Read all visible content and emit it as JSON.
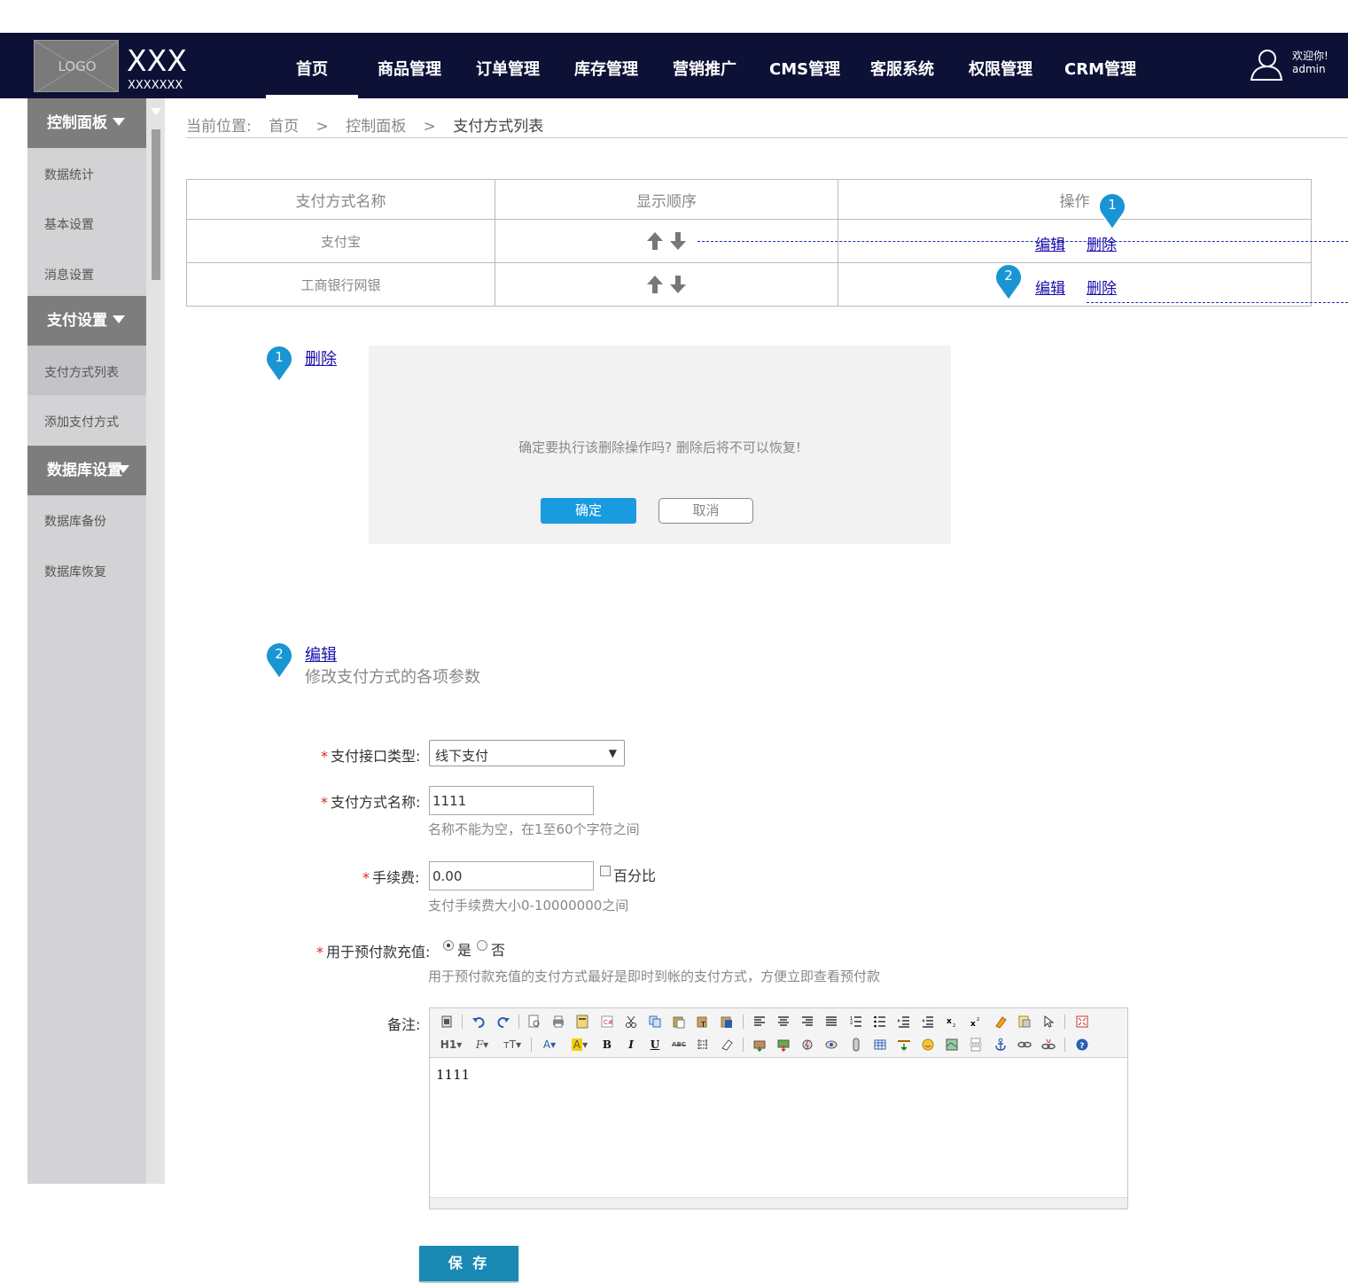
{
  "header": {
    "logo": "LOGO",
    "site_name": "XXX",
    "site_sub": "XXXXXXX",
    "nav": [
      "首页",
      "商品管理",
      "订单管理",
      "库存管理",
      "营销推广",
      "CMS管理",
      "客服系统",
      "权限管理",
      "CRM管理"
    ],
    "welcome": "欢迎你!",
    "username": "admin"
  },
  "sidebar": {
    "sections": [
      {
        "title": "控制面板",
        "items": [
          "数据统计",
          "基本设置",
          "消息设置"
        ]
      },
      {
        "title": "支付设置",
        "items": [
          "支付方式列表",
          "添加支付方式"
        ]
      },
      {
        "title": "数据库设置",
        "items": [
          "数据库备份",
          "数据库恢复"
        ]
      }
    ]
  },
  "breadcrumb": {
    "label": "当前位置:",
    "items": [
      "首页",
      ">",
      "控制面板",
      ">",
      "支付方式列表"
    ]
  },
  "table": {
    "headers": [
      "支付方式名称",
      "显示顺序",
      "操作"
    ],
    "rows": [
      {
        "name": "支付宝",
        "edit": "编辑",
        "delete": "删除"
      },
      {
        "name": "工商银行网银",
        "edit": "编辑",
        "delete": "删除"
      }
    ]
  },
  "pins": [
    "1",
    "2"
  ],
  "delete_dialog": {
    "link": "删除",
    "message": "确定要执行该删除操作吗? 删除后将不可以恢复!",
    "ok": "确定",
    "cancel": "取消"
  },
  "edit_section": {
    "link": "编辑",
    "description": "修改支付方式的各项参数"
  },
  "form": {
    "required_mark": "*",
    "type_label": "支付接口类型:",
    "type_value": "线下支付",
    "name_label": "支付方式名称:",
    "name_value": "1111",
    "name_hint": "名称不能为空，在1至60个字符之间",
    "fee_label": "手续费:",
    "fee_value": "0.00",
    "percent_label": "百分比",
    "fee_hint": "支付手续费大小0-10000000之间",
    "prepay_label": "用于预付款充值:",
    "prepay_yes": "是",
    "prepay_no": "否",
    "prepay_selected": "是",
    "prepay_hint": "用于预付款充值的支付方式最好是即时到帐的支付方式，方便立即查看预付款",
    "remark_label": "备注:",
    "remark_value": "1111",
    "save": "保 存"
  },
  "editor_toolbar": {
    "row2_text": [
      "H1",
      "F",
      "тT",
      "A",
      "A",
      "B",
      "I",
      "U",
      "ABC"
    ]
  },
  "colors": {
    "topbar": "#0d1136",
    "sidebar": "#d3d3d6",
    "sidebar_head": "#7d7d7d",
    "primary_button": "#1a9be0",
    "save_button": "#1a8ab5",
    "pin": "#1a95d3",
    "required": "#e0231b"
  }
}
